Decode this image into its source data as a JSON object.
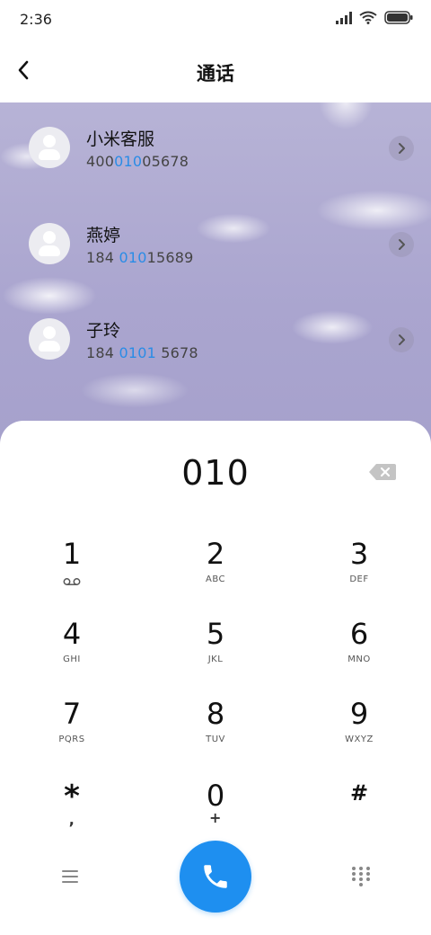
{
  "status_bar": {
    "time": "2:36",
    "icons": [
      "signal-icon",
      "wifi-icon",
      "battery-icon"
    ]
  },
  "header": {
    "title": "通话",
    "back_icon": "back-arrow-icon"
  },
  "results": [
    {
      "name": "小米客服",
      "number_parts": {
        "before": "400",
        "match": "010",
        "after": "05678"
      }
    },
    {
      "name": "燕婷",
      "number_parts": {
        "before": "184 ",
        "match": "010",
        "after": "15689"
      }
    },
    {
      "name": "子玲",
      "number_parts": {
        "before": "184 ",
        "match": "0101",
        "after": " 5678"
      }
    }
  ],
  "dialer": {
    "display": "010",
    "keys": [
      {
        "digit": "1",
        "letters": "",
        "icon": "voicemail-icon"
      },
      {
        "digit": "2",
        "letters": "ABC"
      },
      {
        "digit": "3",
        "letters": "DEF"
      },
      {
        "digit": "4",
        "letters": "GHI"
      },
      {
        "digit": "5",
        "letters": "JKL"
      },
      {
        "digit": "6",
        "letters": "MNO"
      },
      {
        "digit": "7",
        "letters": "PQRS"
      },
      {
        "digit": "8",
        "letters": "TUV"
      },
      {
        "digit": "9",
        "letters": "WXYZ"
      },
      {
        "digit": "*",
        "letters": ","
      },
      {
        "digit": "0",
        "letters": "+"
      },
      {
        "digit": "#",
        "letters": ""
      }
    ]
  },
  "colors": {
    "accent": "#1e8ff0",
    "highlight": "#2a8ce6",
    "results_background": "#aaa5cf"
  },
  "bottom_bar": {
    "left_icon": "menu-icon",
    "center_icon": "phone-icon",
    "right_icon": "keypad-icon"
  }
}
